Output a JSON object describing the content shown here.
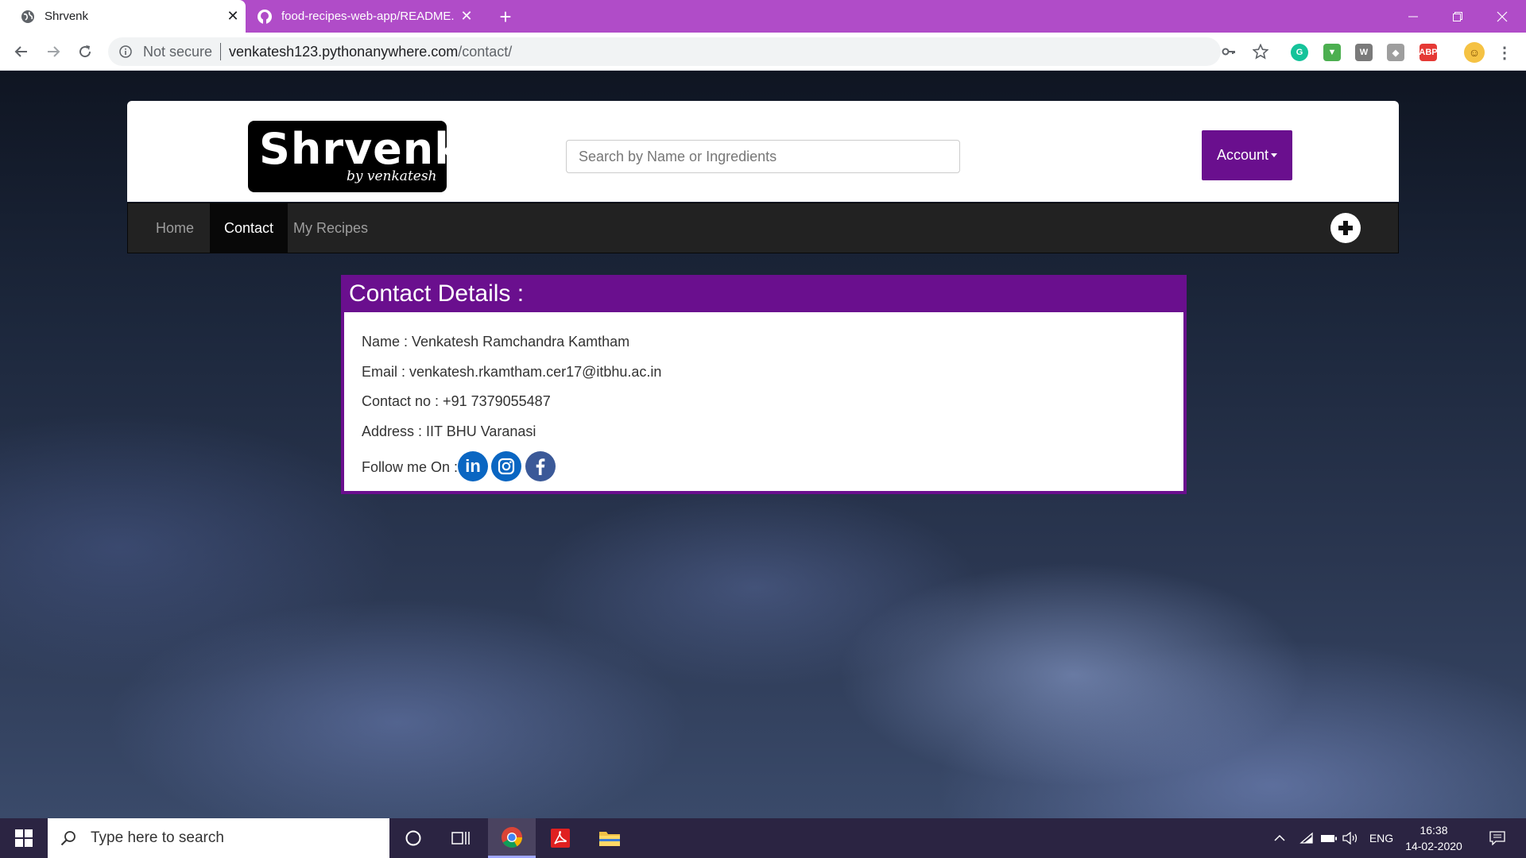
{
  "browser": {
    "tabs": [
      {
        "title": "Shrvenk",
        "active": true,
        "icon": "globe-icon"
      },
      {
        "title": "food-recipes-web-app/README.",
        "active": false,
        "icon": "github-icon"
      }
    ],
    "address": {
      "security_label": "Not secure",
      "host": "venkatesh123.pythonanywhere.com",
      "path": "/contact/"
    }
  },
  "site": {
    "logo": {
      "main": "Shrvenk",
      "sub": "by venkatesh"
    },
    "search_placeholder": "Search by Name or Ingredients",
    "account_label": "Account",
    "nav": [
      {
        "label": "Home",
        "active": false
      },
      {
        "label": "Contact",
        "active": true
      },
      {
        "label": "My Recipes",
        "active": false
      }
    ],
    "brand_color": "#6a0f8e"
  },
  "contact": {
    "heading": "Contact Details :",
    "name": "Name : Venkatesh Ramchandra Kamtham",
    "email": "Email : venkatesh.rkamtham.cer17@itbhu.ac.in",
    "phone": "Contact no : +91 7379055487",
    "address": "Address : IIT BHU Varanasi",
    "follow": "Follow me On :",
    "socials": [
      "linkedin-icon",
      "instagram-icon",
      "facebook-icon"
    ]
  },
  "taskbar": {
    "search_placeholder": "Type here to search",
    "language": "ENG",
    "time": "16:38",
    "date": "14-02-2020"
  }
}
